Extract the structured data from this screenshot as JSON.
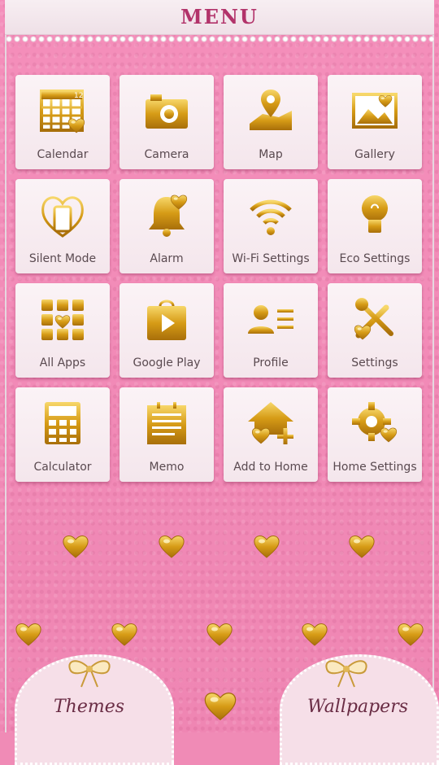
{
  "header": {
    "title": "MENU"
  },
  "apps": [
    {
      "label": "Calendar",
      "icon": "calendar-icon"
    },
    {
      "label": "Camera",
      "icon": "camera-icon"
    },
    {
      "label": "Map",
      "icon": "map-icon"
    },
    {
      "label": "Gallery",
      "icon": "gallery-icon"
    },
    {
      "label": "Silent Mode",
      "icon": "silent-mode-icon"
    },
    {
      "label": "Alarm",
      "icon": "alarm-bell-icon"
    },
    {
      "label": "Wi-Fi Settings",
      "icon": "wifi-icon"
    },
    {
      "label": "Eco Settings",
      "icon": "bulb-icon"
    },
    {
      "label": "All Apps",
      "icon": "all-apps-grid-icon"
    },
    {
      "label": "Google Play",
      "icon": "google-play-icon"
    },
    {
      "label": "Profile",
      "icon": "profile-icon"
    },
    {
      "label": "Settings",
      "icon": "tools-icon"
    },
    {
      "label": "Calculator",
      "icon": "calculator-icon"
    },
    {
      "label": "Memo",
      "icon": "memo-icon"
    },
    {
      "label": "Add to Home",
      "icon": "add-home-icon"
    },
    {
      "label": "Home Settings",
      "icon": "gear-icon"
    }
  ],
  "calendar_number": "12",
  "bottom": {
    "themes_label": "Themes",
    "wallpapers_label": "Wallpapers"
  },
  "colors": {
    "gold": "#d9a21a",
    "pink": "#f08bb6",
    "title": "#b2336a"
  }
}
